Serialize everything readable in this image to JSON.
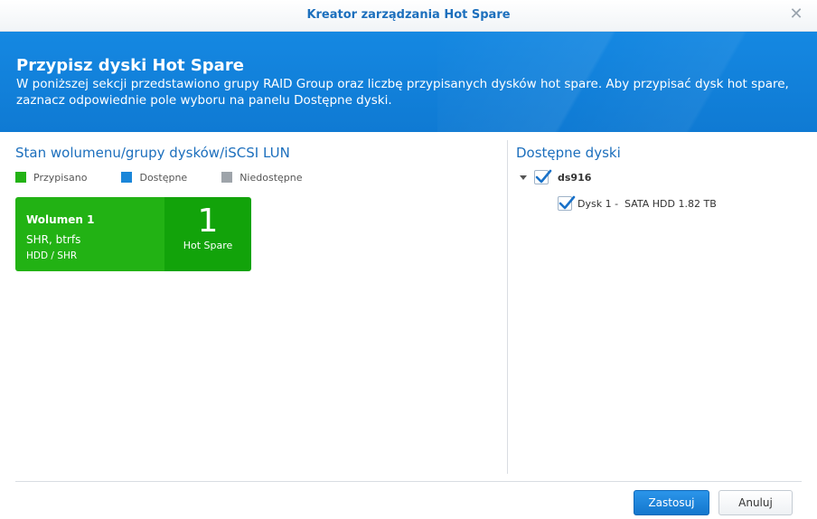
{
  "window": {
    "title": "Kreator zarządzania Hot Spare",
    "close_icon": "close-icon"
  },
  "banner": {
    "title": "Przypisz dyski Hot Spare",
    "description": "W poniższej sekcji przedstawiono grupy RAID Group oraz liczbę przypisanych dysków hot spare. Aby przypisać dysk hot spare, zaznacz odpowiednie pole wyboru na panelu Dostępne dyski."
  },
  "left_panel": {
    "title": "Stan wolumenu/grupy dysków/iSCSI LUN",
    "legend": [
      {
        "label": "Przypisano",
        "color": "#22b214"
      },
      {
        "label": "Dostępne",
        "color": "#1a86d9"
      },
      {
        "label": "Niedostępne",
        "color": "#9ea4aa"
      }
    ],
    "volume": {
      "name": "Wolumen 1",
      "type": "SHR, btrfs",
      "media": "HDD / SHR",
      "count": "1",
      "count_label": "Hot Spare"
    }
  },
  "right_panel": {
    "title": "Dostępne dyski",
    "tree": {
      "root": {
        "label": "ds916",
        "checked": true,
        "expanded": true
      },
      "children": [
        {
          "label": "Dysk 1 -  SATA HDD 1.82 TB",
          "checked": true
        }
      ]
    }
  },
  "footer": {
    "apply_label": "Zastosuj",
    "cancel_label": "Anuluj"
  },
  "colors": {
    "accent": "#1c6fbd",
    "banner": "#1588e2",
    "assigned": "#22b214"
  }
}
